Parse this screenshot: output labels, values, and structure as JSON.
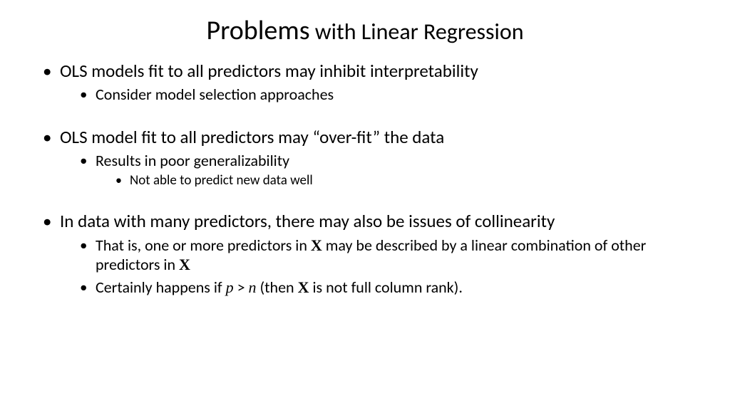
{
  "title": {
    "main": "Problems",
    "sub": " with Linear Regression"
  },
  "bullets": {
    "b1": "OLS models fit to all predictors may inhibit interpretability",
    "b1_1": "Consider model selection approaches",
    "b2": "OLS model fit to all predictors may “over-fit” the data",
    "b2_1": "Results in poor generalizability",
    "b2_1_1": "Not able to predict new data well",
    "b3": "In data with many predictors, there may also be issues of collinearity",
    "b3_1_pre": "That is, one or more predictors in ",
    "b3_1_mid": " may be described by a linear combination of other predictors in ",
    "b3_2_pre": "Certainly happens if ",
    "b3_2_mid": "  (then ",
    "b3_2_post": " is not full column rank)."
  },
  "math": {
    "X": "X",
    "p": "p",
    "gt": " > ",
    "n": "n"
  }
}
